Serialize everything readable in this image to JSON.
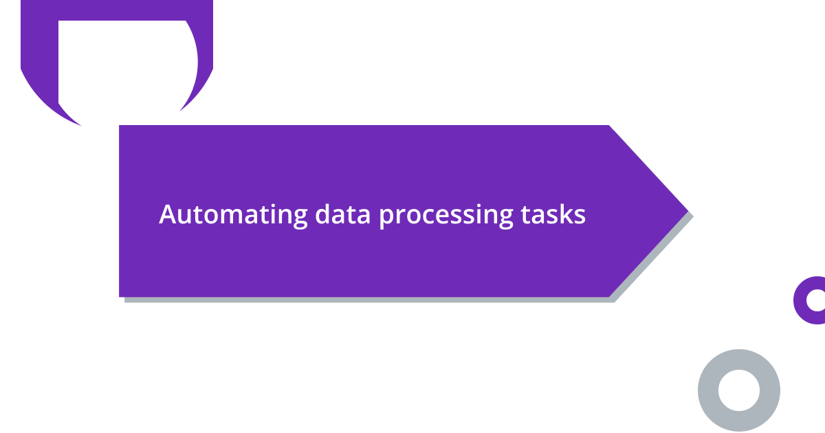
{
  "banner": {
    "title": "Automating data processing tasks"
  },
  "colors": {
    "primary": "#6f2bb7",
    "shadow": "#aeb6bd",
    "gray": "#aeb6bd"
  }
}
